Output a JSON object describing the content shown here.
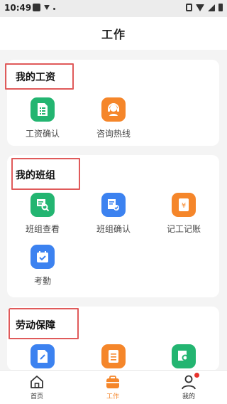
{
  "status_bar": {
    "time": "10:49"
  },
  "header": {
    "title": "工作"
  },
  "sections": [
    {
      "title": "我的工资",
      "items": [
        {
          "label": "工资确认",
          "icon": "document-icon",
          "color": "#23b571"
        },
        {
          "label": "咨询热线",
          "icon": "headset-icon",
          "color": "#f5862a"
        }
      ]
    },
    {
      "title": "我的班组",
      "items": [
        {
          "label": "班组查看",
          "icon": "team-search-icon",
          "color": "#23b571"
        },
        {
          "label": "班组确认",
          "icon": "team-check-icon",
          "color": "#3c82f0"
        },
        {
          "label": "记工记账",
          "icon": "ledger-yuan-icon",
          "color": "#f5862a"
        },
        {
          "label": "考勤",
          "icon": "calendar-check-icon",
          "color": "#3c82f0"
        }
      ]
    },
    {
      "title": "劳动保障",
      "items": [
        {
          "label": "",
          "icon": "document-edit-icon",
          "color": "#3c82f0"
        },
        {
          "label": "",
          "icon": "list-icon",
          "color": "#f5862a"
        },
        {
          "label": "",
          "icon": "document-search-icon",
          "color": "#23b571"
        }
      ]
    }
  ],
  "tabbar": {
    "tabs": [
      {
        "label": "首页",
        "icon": "home-icon"
      },
      {
        "label": "工作",
        "icon": "briefcase-icon",
        "active": true,
        "color": "#f5862a"
      },
      {
        "label": "我的",
        "icon": "user-icon",
        "badge": true,
        "badge_color": "#e8332d"
      }
    ]
  }
}
